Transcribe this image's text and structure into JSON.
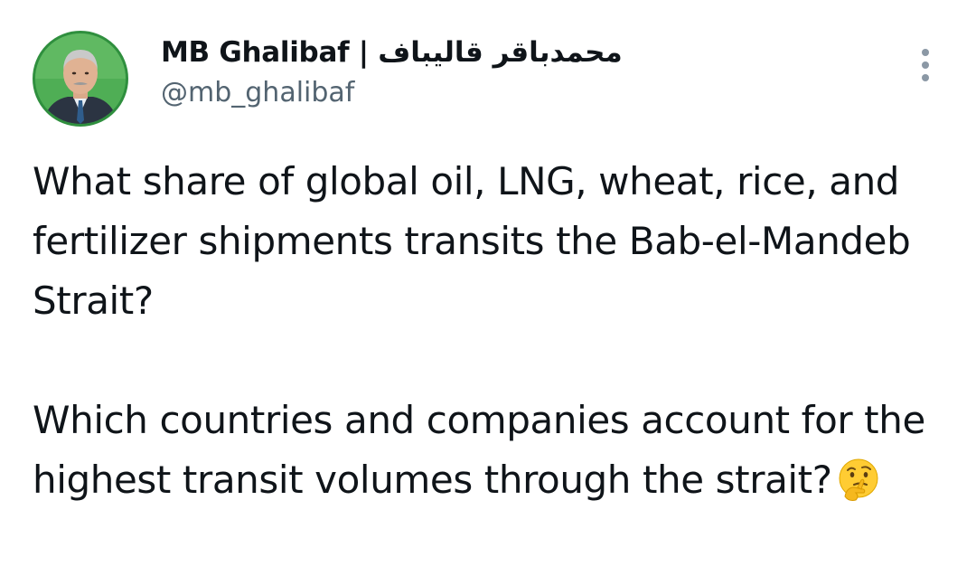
{
  "author": {
    "display_name": "MB Ghalibaf | محمدباقر قالیباف",
    "handle": "@mb_ghalibaf",
    "avatar_icon": "profile-photo"
  },
  "menu": {
    "icon": "more-options-icon"
  },
  "tweet": {
    "paragraph_1": "What share of global oil, LNG, wheat, rice, and fertilizer shipments transits the Bab-el-Mandeb Strait?",
    "paragraph_2": "Which countries and companies account for the highest transit volumes through the strait?",
    "emoji": "thinking-face-emoji"
  },
  "colors": {
    "text": "#0f1419",
    "secondary": "#536471",
    "avatar_ring": "#3aa64a"
  }
}
